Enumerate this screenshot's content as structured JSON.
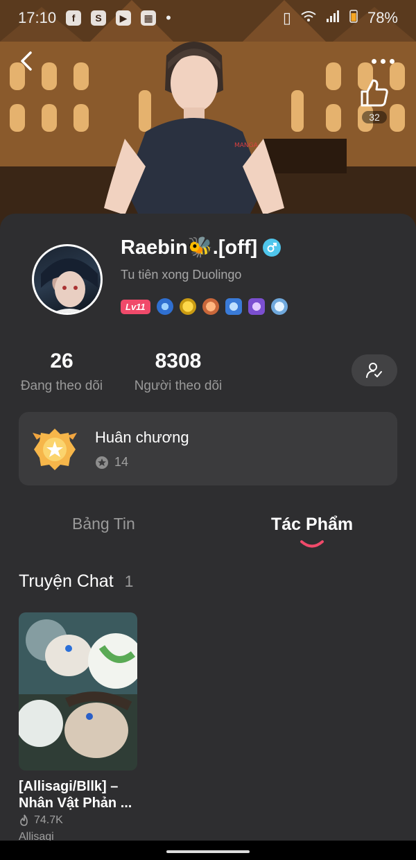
{
  "status_bar": {
    "time": "17:10",
    "battery": "78%"
  },
  "header": {
    "like_count": "32"
  },
  "profile": {
    "username": "Raebin🐝.[off]",
    "bio": "Tu tiên xong Duolingo",
    "level": "Lv11"
  },
  "stats": {
    "following_count": "26",
    "following_label": "Đang theo dõi",
    "followers_count": "8308",
    "followers_label": "Người theo dõi"
  },
  "medal_card": {
    "title": "Huân chương",
    "count": "14"
  },
  "tabs": [
    {
      "label": "Bảng Tin",
      "active": false
    },
    {
      "label": "Tác Phẩm",
      "active": true
    }
  ],
  "section": {
    "title": "Truyện Chat",
    "count": "1"
  },
  "stories": [
    {
      "title_line1": "[Allisagi/Bllk] –",
      "title_line2": "Nhân Vật Phản ...",
      "views": "74.7K",
      "author": "Allisagi"
    }
  ],
  "colors": {
    "accent": "#f04a6a",
    "gender": "#4fc6ec",
    "background": "#2e2e30"
  }
}
